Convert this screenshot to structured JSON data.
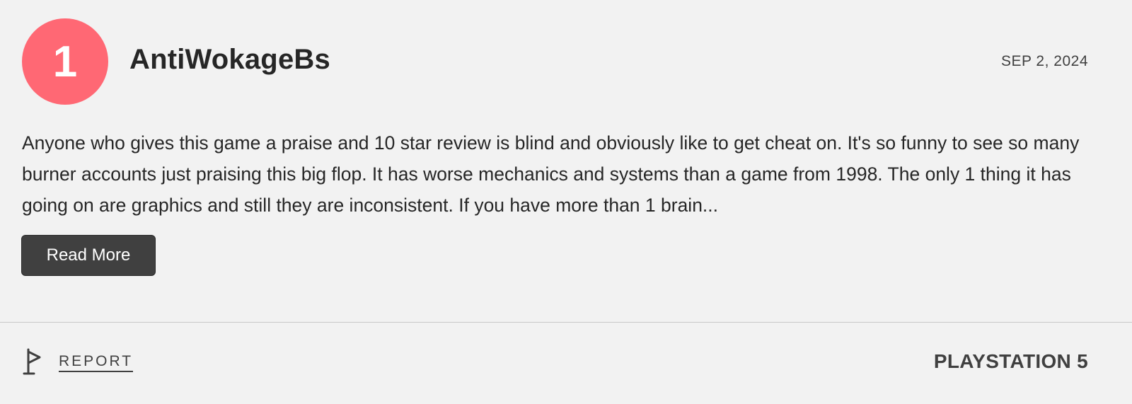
{
  "review": {
    "score": "1",
    "username": "AntiWokageBs",
    "date": "SEP 2, 2024",
    "body": "Anyone who gives this game a praise and 10 star review is blind and obviously like to get cheat on. It's so funny to see so many burner accounts just praising this big flop. It has worse mechanics and systems than a game from 1998. The only 1 thing it has going on are graphics and still they are inconsistent. If you have more than 1 brain...",
    "read_more_label": "Read More",
    "report_label": "REPORT",
    "platform": "PLAYSTATION 5"
  },
  "icons": {
    "report": "flag-icon"
  },
  "colors": {
    "score_badge": "#ff6874",
    "button_bg": "#404040",
    "background": "#f2f2f2"
  }
}
